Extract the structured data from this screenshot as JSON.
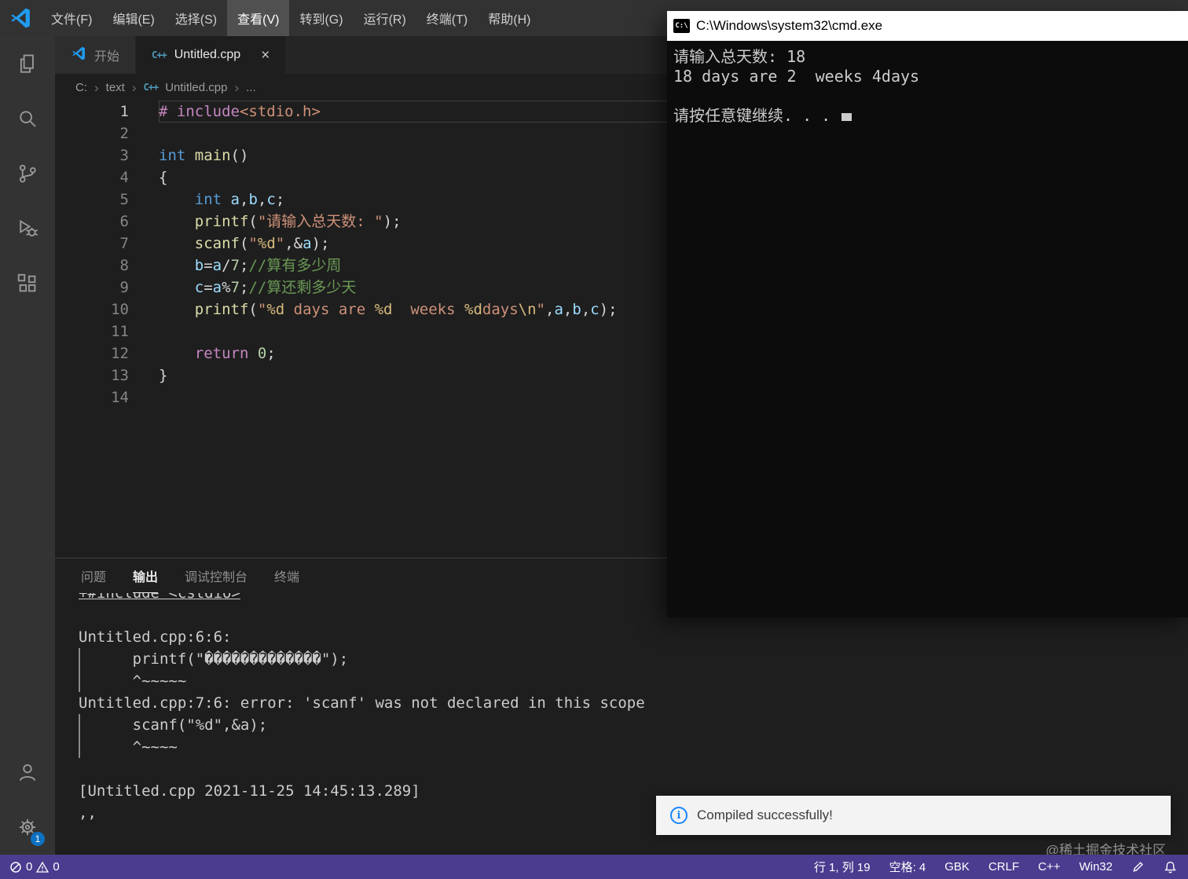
{
  "colors": {
    "status_bar": "#4b3c8f",
    "badge": "#0e70c0",
    "info_icon": "#1a85ff",
    "string": "#ce9178",
    "comment": "#6a9955",
    "keyword": "#569cd6"
  },
  "window": {
    "menu_items": [
      "文件(F)",
      "编辑(E)",
      "选择(S)",
      "查看(V)",
      "转到(G)",
      "运行(R)",
      "终端(T)",
      "帮助(H)"
    ],
    "active_menu": "查看(V)"
  },
  "tabs": {
    "start_tab": "开始",
    "file_tab": "Untitled.cpp"
  },
  "icons": {
    "close": "×",
    "breadcrumb_separator": "›",
    "info": "i",
    "cmd_logo": "C:\\",
    "cpp_file": "C++"
  },
  "breadcrumb": {
    "drive": "C:",
    "folder": "text",
    "file": "Untitled.cpp",
    "more": "..."
  },
  "editor": {
    "lines": [
      {
        "n": "1",
        "current": true,
        "tokens": [
          [
            "mag",
            "# include"
          ],
          [
            "str",
            "<stdio.h>"
          ]
        ]
      },
      {
        "n": "2",
        "tokens": []
      },
      {
        "n": "3",
        "tokens": [
          [
            "kw",
            "int"
          ],
          [
            "pln",
            " "
          ],
          [
            "fn",
            "main"
          ],
          [
            "pln",
            "()"
          ]
        ]
      },
      {
        "n": "4",
        "tokens": [
          [
            "pln",
            "{"
          ]
        ]
      },
      {
        "n": "5",
        "tokens": [
          [
            "pln",
            "    "
          ],
          [
            "kw",
            "int"
          ],
          [
            "pln",
            " "
          ],
          [
            "var",
            "a"
          ],
          [
            "pln",
            ","
          ],
          [
            "var",
            "b"
          ],
          [
            "pln",
            ","
          ],
          [
            "var",
            "c"
          ],
          [
            "pln",
            ";"
          ]
        ]
      },
      {
        "n": "6",
        "tokens": [
          [
            "pln",
            "    "
          ],
          [
            "fn",
            "printf"
          ],
          [
            "pln",
            "("
          ],
          [
            "str",
            "\"请输入总天数: \""
          ],
          [
            "pln",
            ");"
          ]
        ]
      },
      {
        "n": "7",
        "tokens": [
          [
            "pln",
            "    "
          ],
          [
            "fn",
            "scanf"
          ],
          [
            "pln",
            "("
          ],
          [
            "str",
            "\""
          ],
          [
            "esc",
            "%d"
          ],
          [
            "str",
            "\""
          ],
          [
            "pln",
            ",&"
          ],
          [
            "var",
            "a"
          ],
          [
            "pln",
            ");"
          ]
        ]
      },
      {
        "n": "8",
        "tokens": [
          [
            "pln",
            "    "
          ],
          [
            "var",
            "b"
          ],
          [
            "pln",
            "="
          ],
          [
            "var",
            "a"
          ],
          [
            "pln",
            "/"
          ],
          [
            "num",
            "7"
          ],
          [
            "pln",
            ";"
          ],
          [
            "cmt",
            "//算有多少周"
          ]
        ]
      },
      {
        "n": "9",
        "tokens": [
          [
            "pln",
            "    "
          ],
          [
            "var",
            "c"
          ],
          [
            "pln",
            "="
          ],
          [
            "var",
            "a"
          ],
          [
            "pln",
            "%"
          ],
          [
            "num",
            "7"
          ],
          [
            "pln",
            ";"
          ],
          [
            "cmt",
            "//算还剩多少天"
          ]
        ]
      },
      {
        "n": "10",
        "tokens": [
          [
            "pln",
            "    "
          ],
          [
            "fn",
            "printf"
          ],
          [
            "pln",
            "("
          ],
          [
            "str",
            "\""
          ],
          [
            "esc",
            "%d"
          ],
          [
            "str",
            " days are "
          ],
          [
            "esc",
            "%d"
          ],
          [
            "str",
            "  weeks "
          ],
          [
            "esc",
            "%d"
          ],
          [
            "str",
            "days"
          ],
          [
            "esc",
            "\\n"
          ],
          [
            "str",
            "\""
          ],
          [
            "pln",
            ","
          ],
          [
            "var",
            "a"
          ],
          [
            "pln",
            ","
          ],
          [
            "var",
            "b"
          ],
          [
            "pln",
            ","
          ],
          [
            "var",
            "c"
          ],
          [
            "pln",
            ");"
          ]
        ]
      },
      {
        "n": "11",
        "tokens": []
      },
      {
        "n": "12",
        "tokens": [
          [
            "pln",
            "    "
          ],
          [
            "mag",
            "return"
          ],
          [
            "pln",
            " "
          ],
          [
            "num",
            "0"
          ],
          [
            "pln",
            ";"
          ]
        ]
      },
      {
        "n": "13",
        "tokens": [
          [
            "pln",
            "}"
          ]
        ]
      },
      {
        "n": "14",
        "tokens": []
      }
    ]
  },
  "panel": {
    "tabs": [
      "问题",
      "输出",
      "调试控制台",
      "终端"
    ],
    "active_tab": "输出",
    "output": [
      {
        "text": "+#include <cstdio>",
        "underline": true
      },
      {
        "text": ""
      },
      {
        "text": "Untitled.cpp:6:6:"
      },
      {
        "text": "      printf(\"�������������\");",
        "bar": true
      },
      {
        "text": "      ^~~~~~",
        "bar": true
      },
      {
        "text": "Untitled.cpp:7:6: error: 'scanf' was not declared in this scope"
      },
      {
        "text": "      scanf(\"%d\",&a);",
        "bar": true
      },
      {
        "text": "      ^~~~~",
        "bar": true
      },
      {
        "text": ""
      },
      {
        "text": "[Untitled.cpp 2021-11-25 14:45:13.289]"
      },
      {
        "text": ",,"
      }
    ]
  },
  "cmd": {
    "title": "C:\\Windows\\system32\\cmd.exe",
    "lines": [
      "请输入总天数: 18",
      "18 days are 2  weeks 4days",
      "",
      "请按任意键继续. . . "
    ]
  },
  "notification": {
    "message": "Compiled successfully!"
  },
  "watermark": {
    "text": "@稀土掘金技术社区"
  },
  "activity_bar": {
    "settings_badge": "1"
  },
  "status_bar": {
    "errors": "0",
    "warnings": "0",
    "line_col": "行 1, 列 19",
    "spaces": "空格: 4",
    "encoding": "GBK",
    "eol": "CRLF",
    "language": "C++",
    "platform": "Win32"
  }
}
